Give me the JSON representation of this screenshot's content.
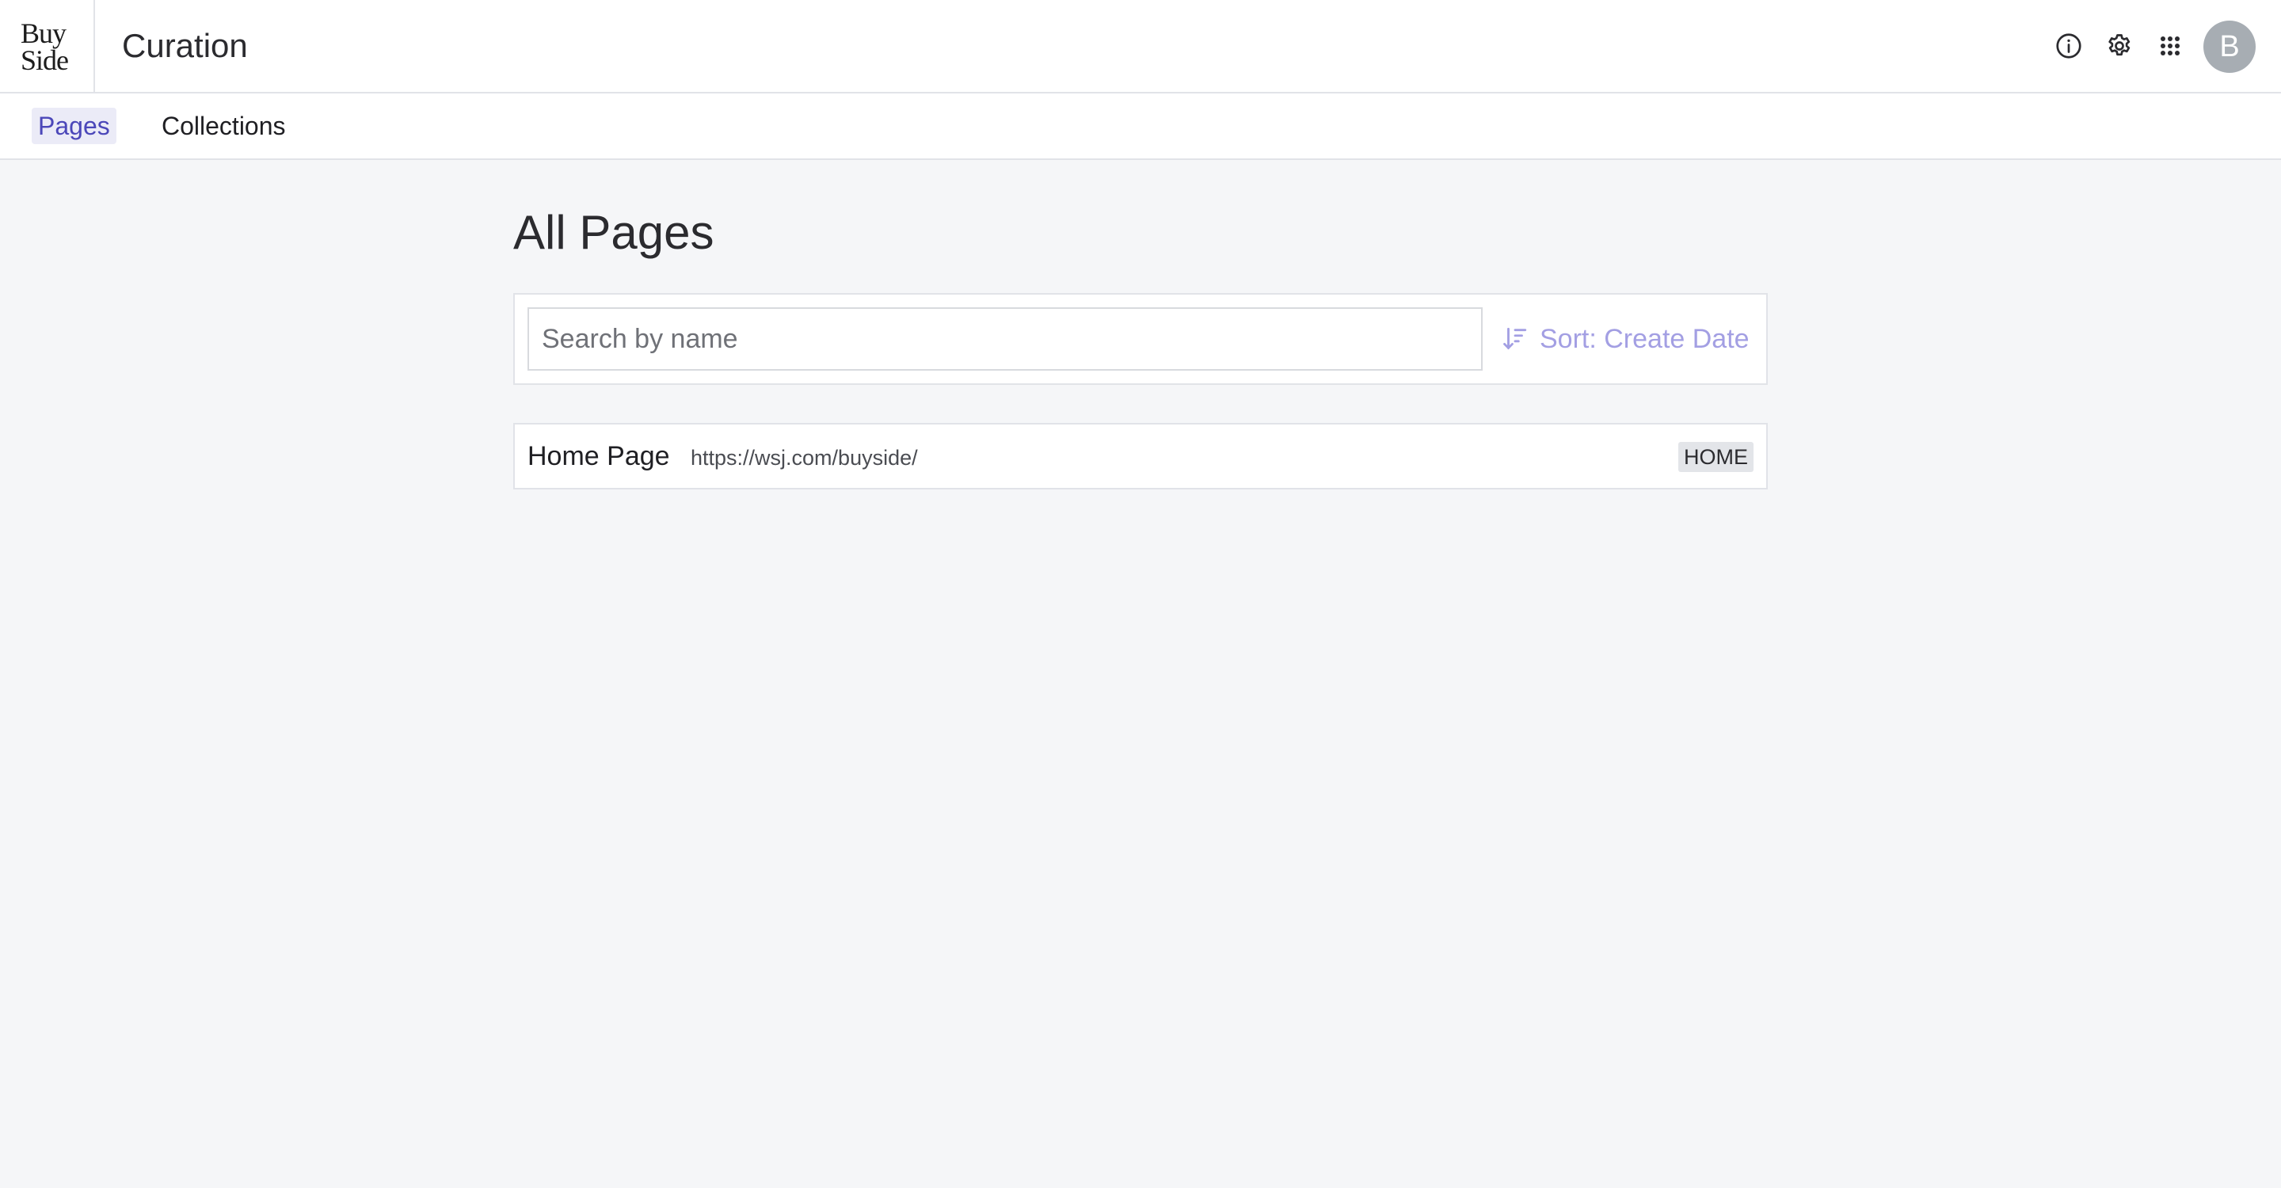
{
  "header": {
    "logo": {
      "line1": "Buy",
      "line2": "Side"
    },
    "app_title": "Curation",
    "icons": [
      "info-icon",
      "gear-icon",
      "apps-grid-icon"
    ],
    "avatar_initial": "B"
  },
  "tabs": [
    {
      "label": "Pages",
      "active": true
    },
    {
      "label": "Collections",
      "active": false
    }
  ],
  "main": {
    "heading": "All Pages",
    "search": {
      "placeholder": "Search by name",
      "value": ""
    },
    "sort_label": "Sort: Create Date",
    "pages": [
      {
        "name": "Home Page",
        "url": "https://wsj.com/buyside/",
        "badge": "HOME"
      }
    ]
  },
  "colors": {
    "accent": "#4b47b9",
    "sort_text": "#a39fe3",
    "background": "#f5f6f8",
    "avatar": "#a7adb3"
  }
}
